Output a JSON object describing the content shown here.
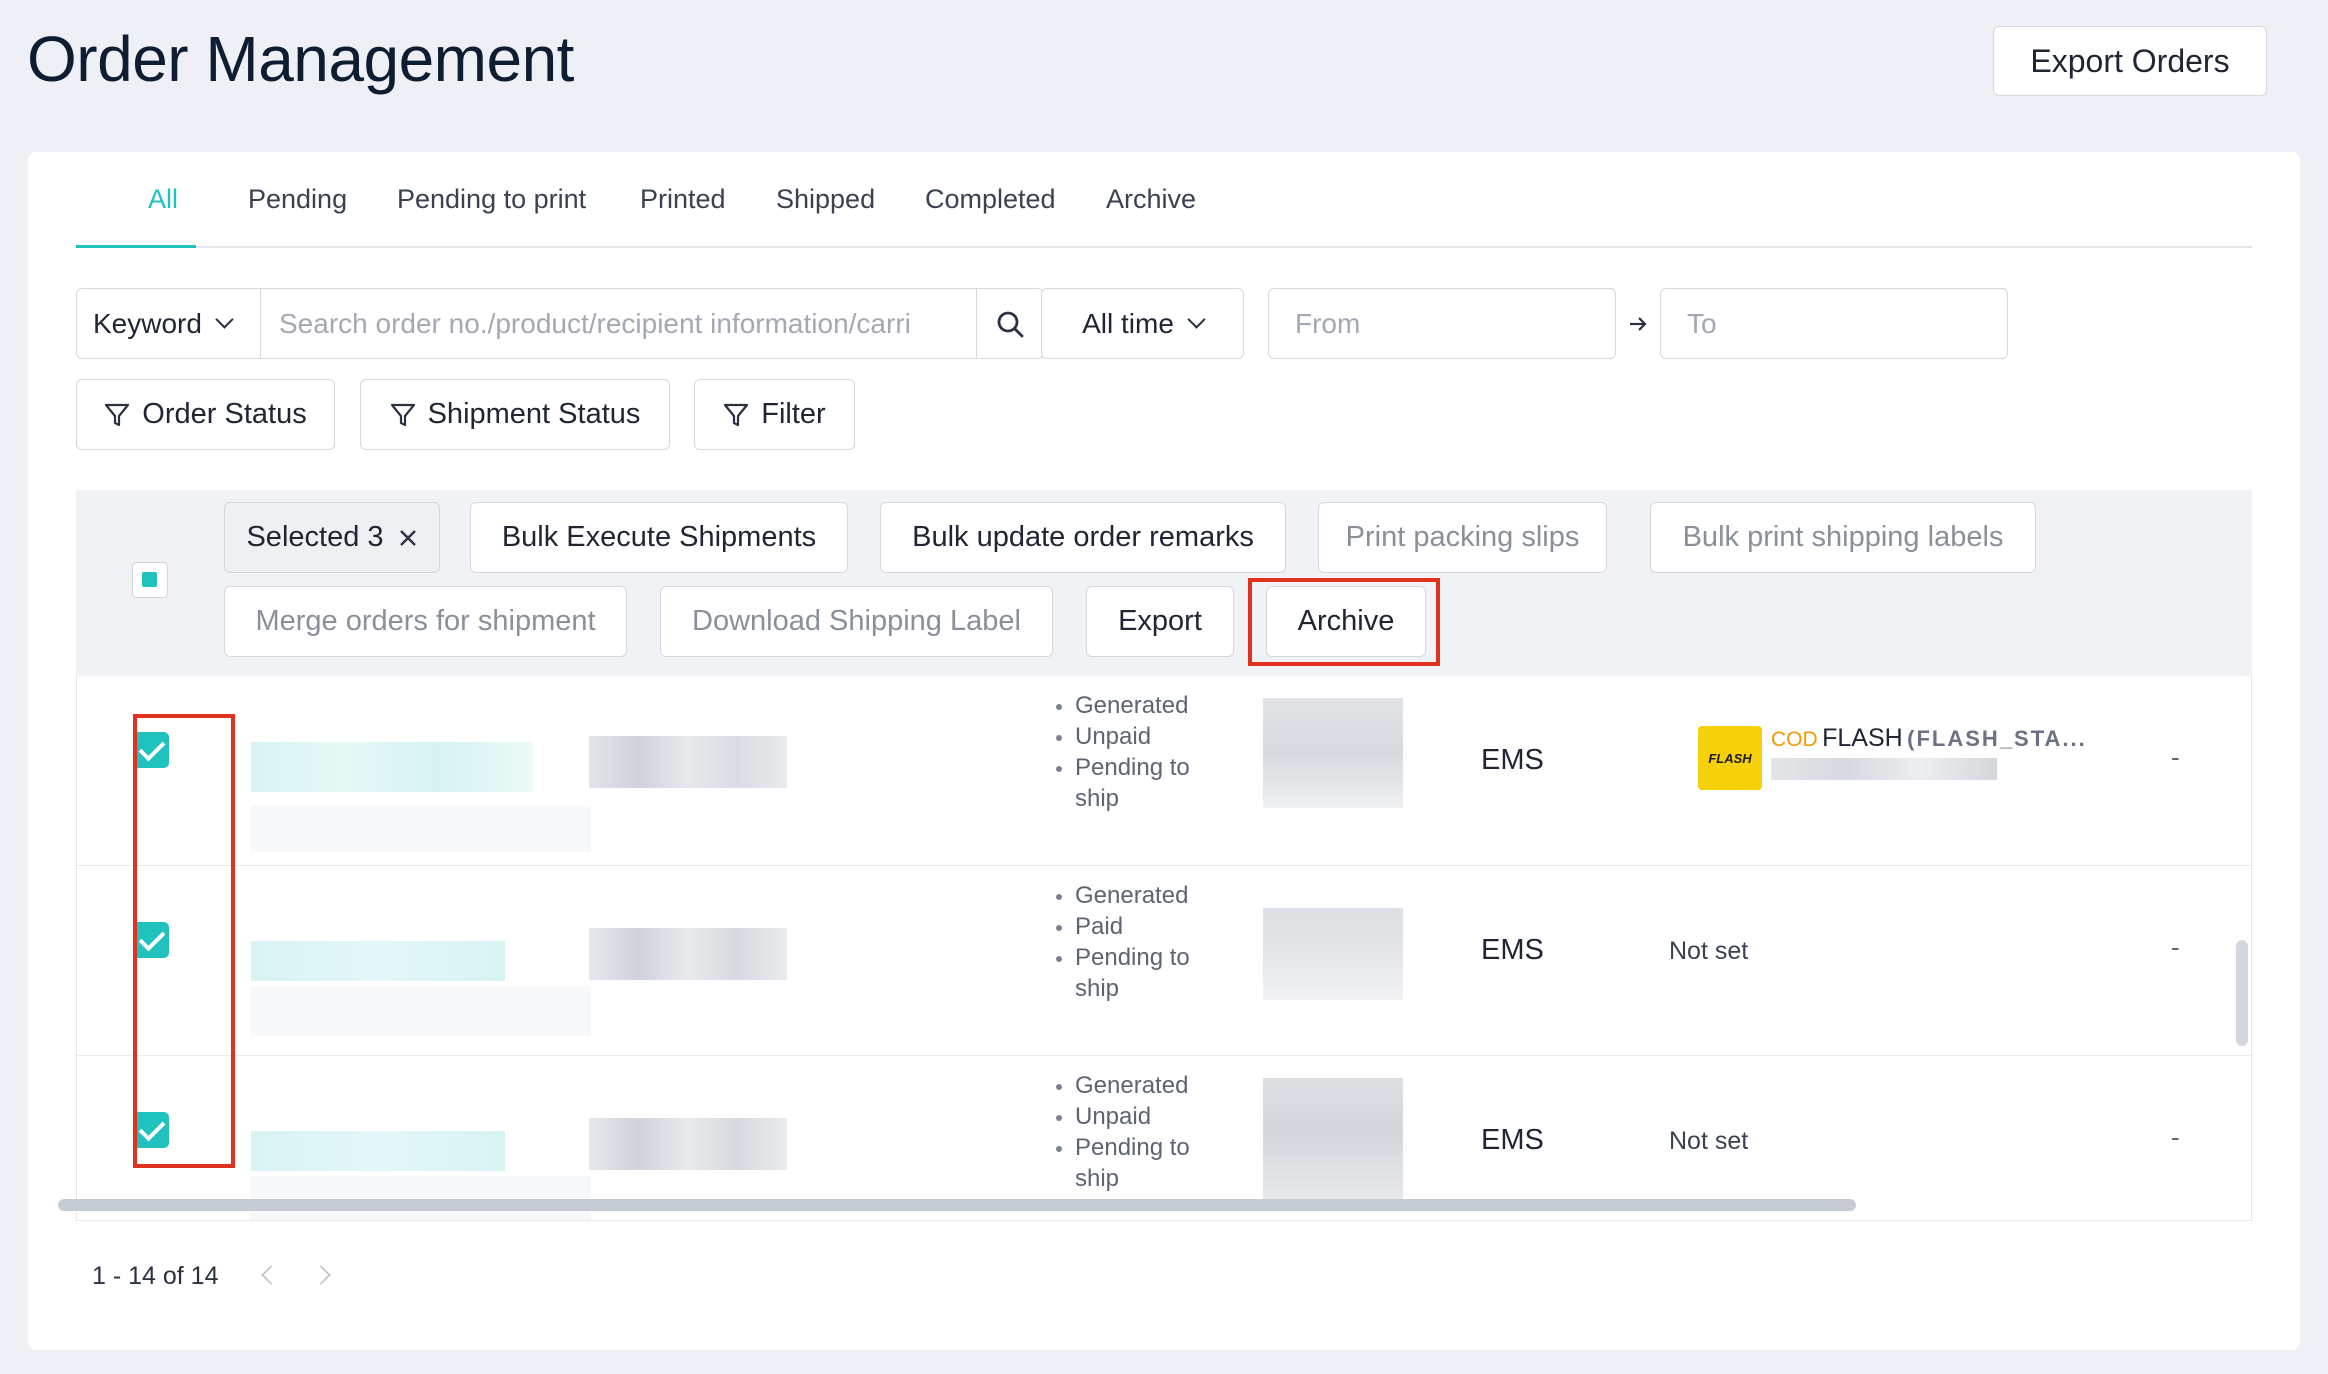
{
  "page": {
    "title": "Order Management",
    "export_orders_label": "Export Orders"
  },
  "tabs": [
    {
      "label": "All",
      "active": true
    },
    {
      "label": "Pending"
    },
    {
      "label": "Pending to print"
    },
    {
      "label": "Printed"
    },
    {
      "label": "Shipped"
    },
    {
      "label": "Completed"
    },
    {
      "label": "Archive"
    }
  ],
  "search": {
    "keyword_select": "Keyword",
    "placeholder": "Search order no./product/recipient information/carri",
    "time_select": "All time",
    "from_placeholder": "From",
    "to_placeholder": "To"
  },
  "filters": {
    "order_status": "Order Status",
    "shipment_status": "Shipment Status",
    "filter": "Filter"
  },
  "bulk": {
    "selected_label": "Selected 3",
    "bulk_execute": "Bulk Execute Shipments",
    "bulk_update_remarks": "Bulk update order remarks",
    "print_packing_slips": "Print packing slips",
    "bulk_print_labels": "Bulk print shipping labels",
    "merge_orders": "Merge orders for shipment",
    "download_label": "Download Shipping Label",
    "export": "Export",
    "archive": "Archive"
  },
  "rows": [
    {
      "checked": true,
      "statuses": [
        "Generated",
        "Unpaid",
        "Pending to ship"
      ],
      "carrier": "EMS",
      "logistics": {
        "cod": "COD",
        "name": "FLASH",
        "code": "(FLASH_STA...",
        "logo_text": "FLASH"
      },
      "remark": "-"
    },
    {
      "checked": true,
      "statuses": [
        "Generated",
        "Paid",
        "Pending to ship"
      ],
      "carrier": "EMS",
      "logistics_text": "Not set",
      "remark": "-"
    },
    {
      "checked": true,
      "statuses": [
        "Generated",
        "Unpaid",
        "Pending to ship"
      ],
      "carrier": "EMS",
      "logistics_text": "Not set",
      "remark": "-"
    }
  ],
  "pagination": {
    "range": "1 - 14 of 14"
  },
  "colors": {
    "accent": "#1fc2bd",
    "highlight": "#e0321f",
    "flash_yellow": "#f6d10a",
    "cod_orange": "#f09a00"
  }
}
